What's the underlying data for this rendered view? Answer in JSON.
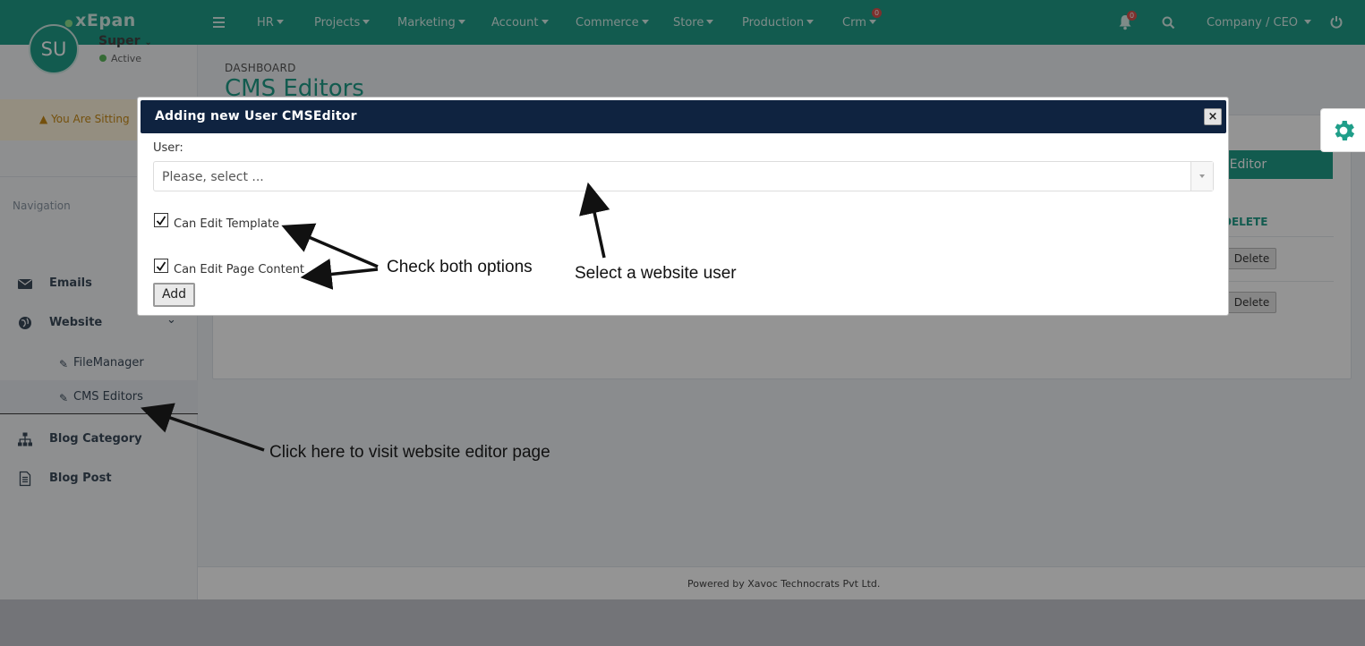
{
  "topbar": {
    "logo": "xEpan",
    "menu": [
      {
        "label": "HR"
      },
      {
        "label": "Projects"
      },
      {
        "label": "Marketing"
      },
      {
        "label": "Account"
      },
      {
        "label": "Commerce"
      },
      {
        "label": "Store"
      },
      {
        "label": "Production"
      },
      {
        "label": "Crm",
        "badge": "0"
      }
    ],
    "notifications_badge": "0",
    "company_role": "Company / CEO"
  },
  "sidebar": {
    "avatar_initials": "SU",
    "user_name": "Super",
    "user_status": "Active",
    "warning_text": "You Are Sitting",
    "navigation_heading": "Navigation",
    "items": [
      {
        "label": "Emails"
      },
      {
        "label": "Website"
      },
      {
        "label": "FileManager"
      },
      {
        "label": "CMS Editors"
      },
      {
        "label": "Blog Category"
      },
      {
        "label": "Blog Post"
      }
    ]
  },
  "page": {
    "breadcrumb": "DASHBOARD",
    "title": "CMS Editors",
    "add_button_label": "Add User CMSEditor",
    "column_delete": "DELETE",
    "rows": [
      {
        "delete_label": "Delete"
      },
      {
        "delete_label": "Delete"
      }
    ],
    "footer": "Powered by Xavoc Technocrats Pvt Ltd."
  },
  "modal": {
    "title": "Adding new User CMSEditor",
    "close_symbol": "×",
    "user_label": "User:",
    "user_select_value": "Please, select ...",
    "can_edit_template_label": "Can Edit Template",
    "can_edit_template_checked": true,
    "can_edit_page_content_label": "Can Edit Page Content",
    "can_edit_page_content_checked": true,
    "add_button_label": "Add"
  },
  "annotations": {
    "check_both": "Check both options",
    "select_user": "Select a website user",
    "click_here": "Click here to visit website editor page"
  },
  "colors": {
    "brand": "#1f9e89",
    "modal_header": "#0f2340",
    "badge": "#d9534f"
  }
}
